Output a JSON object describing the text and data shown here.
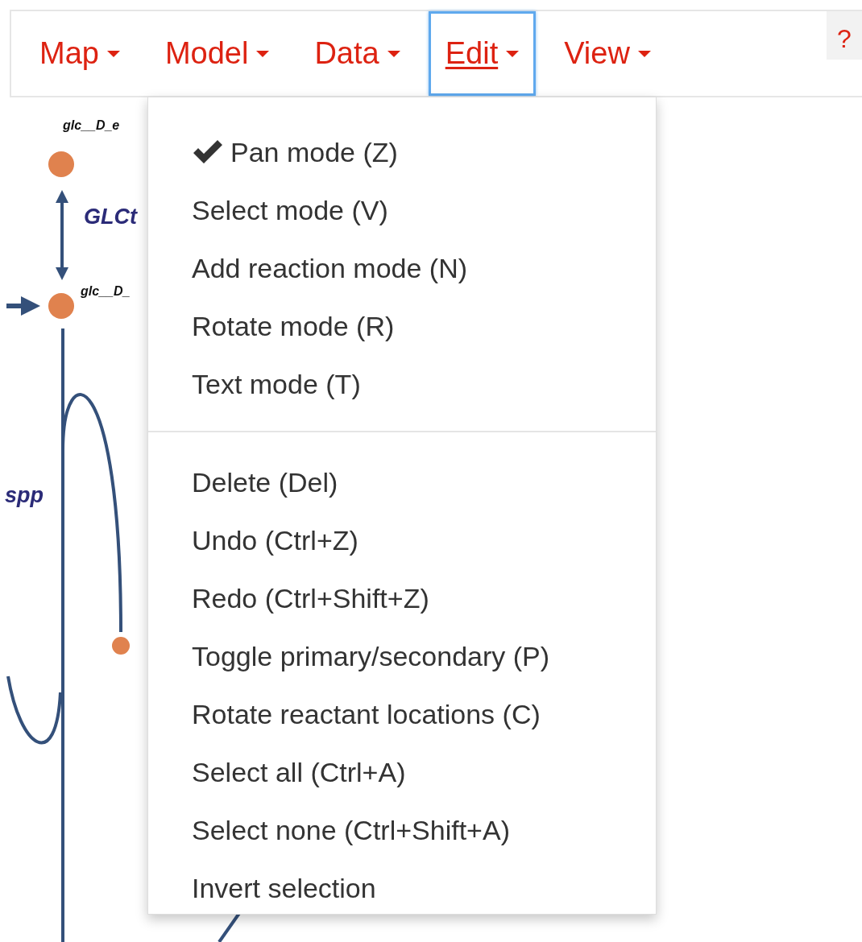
{
  "menubar": [
    {
      "label": "Map",
      "selected": false
    },
    {
      "label": "Model",
      "selected": false
    },
    {
      "label": "Data",
      "selected": false
    },
    {
      "label": "Edit",
      "selected": true
    },
    {
      "label": "View",
      "selected": false
    }
  ],
  "help_button": {
    "label": "?"
  },
  "edit_menu": {
    "items": [
      {
        "kind": "item",
        "label": "Pan mode (Z)",
        "checked": true
      },
      {
        "kind": "item",
        "label": "Select mode (V)",
        "checked": false
      },
      {
        "kind": "item",
        "label": "Add reaction mode (N)",
        "checked": false
      },
      {
        "kind": "item",
        "label": "Rotate mode (R)",
        "checked": false
      },
      {
        "kind": "item",
        "label": "Text mode (T)",
        "checked": false
      },
      {
        "kind": "divider"
      },
      {
        "kind": "item",
        "label": "Delete (Del)"
      },
      {
        "kind": "item",
        "label": "Undo (Ctrl+Z)"
      },
      {
        "kind": "item",
        "label": "Redo (Ctrl+Shift+Z)"
      },
      {
        "kind": "item",
        "label": "Toggle primary/secondary (P)"
      },
      {
        "kind": "item",
        "label": "Rotate reactant locations (C)"
      },
      {
        "kind": "item",
        "label": "Select all (Ctrl+A)"
      },
      {
        "kind": "item",
        "label": "Select none (Ctrl+Shift+A)"
      },
      {
        "kind": "item",
        "label": "Invert selection"
      }
    ]
  },
  "map": {
    "labels": [
      {
        "kind": "metabolite",
        "text": "glc__D_e"
      },
      {
        "kind": "reaction",
        "text": "GLCt"
      },
      {
        "kind": "metabolite",
        "text": "glc__D_"
      },
      {
        "kind": "reaction",
        "text": "spp"
      }
    ]
  }
}
